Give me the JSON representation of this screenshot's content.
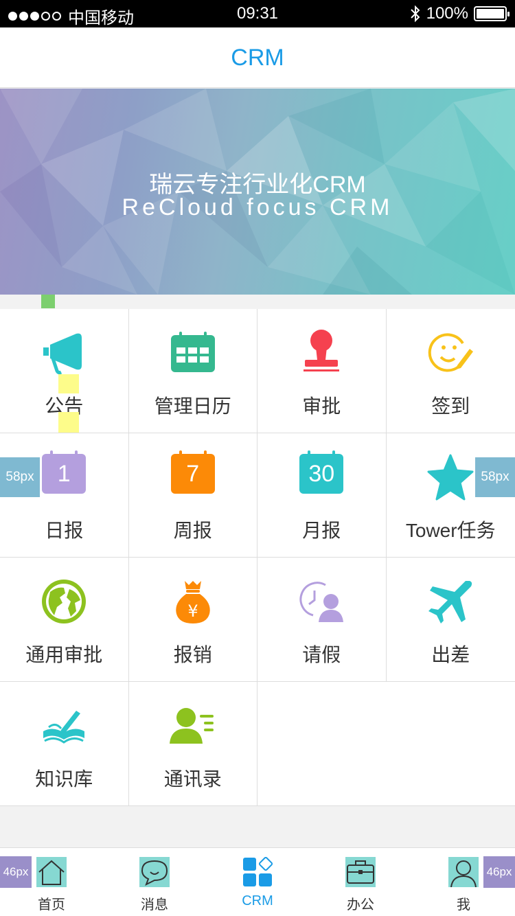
{
  "status_bar": {
    "carrier": "中国移动",
    "time": "09:31",
    "battery": "100%",
    "battery_level": 1.0
  },
  "nav": {
    "title": "CRM"
  },
  "banner": {
    "line1": "瑞云专注行业化CRM",
    "line2": "ReCloud focus CRM"
  },
  "grid": {
    "items": [
      {
        "label": "公告",
        "icon": "megaphone-icon"
      },
      {
        "label": "管理日历",
        "icon": "calendar-icon"
      },
      {
        "label": "审批",
        "icon": "stamp-icon"
      },
      {
        "label": "签到",
        "icon": "smiley-pencil-icon"
      },
      {
        "label": "日报",
        "icon": "calendar-1-icon",
        "number": "1"
      },
      {
        "label": "周报",
        "icon": "calendar-7-icon",
        "number": "7"
      },
      {
        "label": "月报",
        "icon": "calendar-30-icon",
        "number": "30"
      },
      {
        "label": "Tower任务",
        "icon": "star-icon"
      },
      {
        "label": "通用审批",
        "icon": "globe-icon"
      },
      {
        "label": "报销",
        "icon": "money-bag-icon"
      },
      {
        "label": "请假",
        "icon": "clock-person-icon"
      },
      {
        "label": "出差",
        "icon": "airplane-icon"
      },
      {
        "label": "知识库",
        "icon": "book-pen-icon"
      },
      {
        "label": "通讯录",
        "icon": "contacts-icon"
      }
    ]
  },
  "annotations": {
    "cell_margin": "58px",
    "tab_margin": "46px"
  },
  "tabbar": {
    "tabs": [
      {
        "label": "首页",
        "icon": "home-icon"
      },
      {
        "label": "消息",
        "icon": "chat-icon"
      },
      {
        "label": "CRM",
        "icon": "crm-grid-icon",
        "active": true
      },
      {
        "label": "办公",
        "icon": "briefcase-icon"
      },
      {
        "label": "我",
        "icon": "user-icon"
      }
    ]
  },
  "colors": {
    "accent": "#1a9be6",
    "teal": "#2bc4c9",
    "green": "#35b88f",
    "red": "#f5414f",
    "yellow": "#f8c21a",
    "purple": "#b49fde",
    "orange": "#fc8a07",
    "lime": "#8dc21f"
  }
}
